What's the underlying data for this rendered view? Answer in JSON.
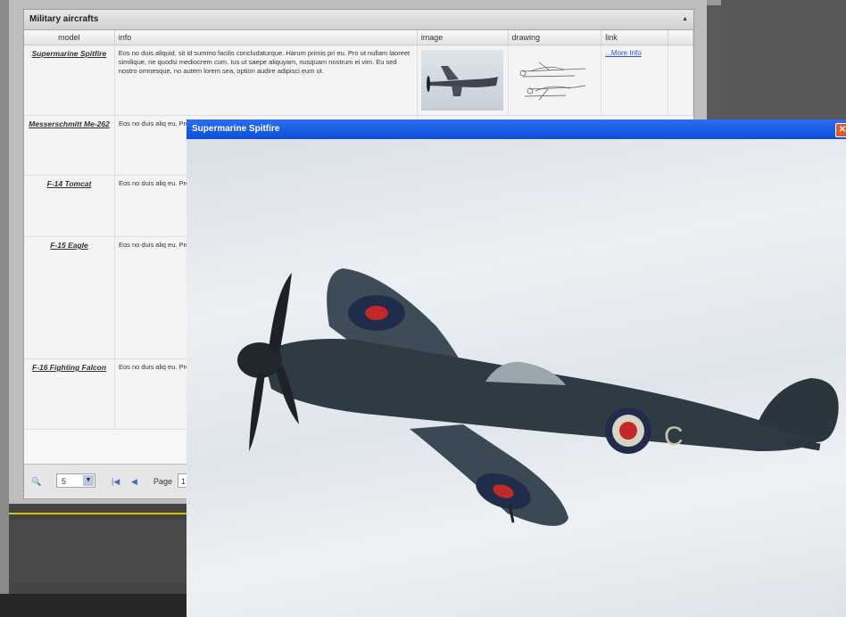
{
  "grid": {
    "title": "Military aircrafts",
    "columns": [
      "model",
      "info",
      "image",
      "drawing",
      "link"
    ],
    "rows": [
      {
        "model": "Supermarine Spitfire",
        "info": "Eos no duis aliquid, sit id summo facilis concludaturque. Harum primis pri eu. Pro ut nullam laoreet similique, ne quodsi mediocrem cum. Ius ut saepe aliquyam, nusquam nostrum ei vim. Eu sed nostro omnesque, no autem lorem sea, option audire adipisci eum ut.",
        "link": "...More Info"
      },
      {
        "model": "Messerschmitt Me-262",
        "info": "Eos no duis aliq eu. Pro ut nullan saepe aliquyam autem lorem sei"
      },
      {
        "model": "F-14 Tomcat",
        "info": "Eos no duis aliq eu. Pro ut nullan saepe aliquyam autem lorem sei"
      },
      {
        "model": "F-15 Eagle",
        "info": "Eos no duis aliq eu. Pro ut nullan saepe aliquyam autem lorem sei"
      },
      {
        "model": "F-16 Fighting Falcon",
        "info": "Eos no duis aliq eu. Pro ut nullan saepe aliquyam autem lorem sei"
      }
    ]
  },
  "pager": {
    "page_size": "5",
    "page_label": "Page",
    "page_value": "1"
  },
  "popup": {
    "title": "Supermarine Spitfire",
    "close_icon": "close-icon"
  },
  "colors": {
    "titlebar": "#0a4fd6",
    "link": "#2a55c4",
    "close": "#e05830"
  }
}
